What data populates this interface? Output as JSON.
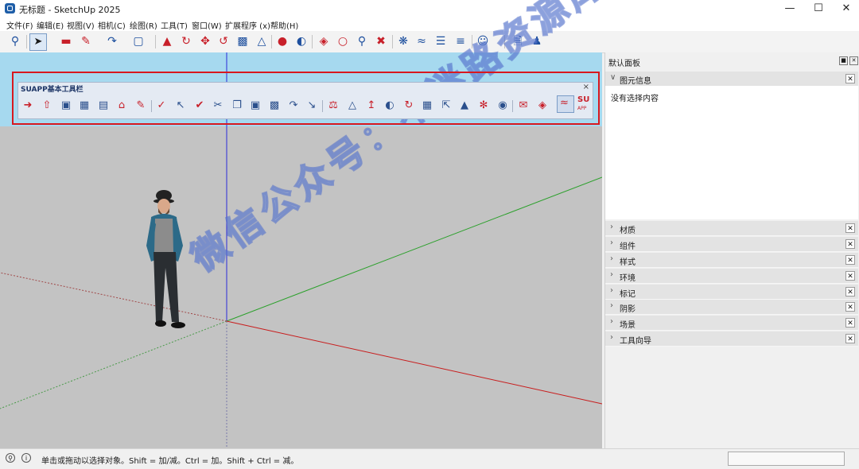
{
  "window": {
    "title": "无标题 - SketchUp 2025",
    "minimize": "—",
    "maximize": "☐",
    "close": "✕"
  },
  "menu": [
    "文件(F)",
    "编辑(E)",
    "视图(V)",
    "相机(C)",
    "绘图(R)",
    "工具(T)",
    "窗口(W)",
    "扩展程序 (x)",
    "帮助(H)"
  ],
  "toolbar": {
    "icons": [
      "search-icon",
      "select-arrow-icon",
      "eraser-icon",
      "pencil-icon",
      "arc-icon",
      "rectangle-icon",
      "push-pull-icon",
      "follow-me-icon",
      "move-icon",
      "rotate-icon",
      "scale-icon",
      "offset-icon",
      "tape-measure-icon",
      "protractor-icon",
      "section-icon",
      "orbit-icon",
      "pan-icon",
      "zoom-icon",
      "zoom-extents-icon",
      "warehouse-icon",
      "extension-warehouse-icon",
      "layout-icon",
      "style-builder-icon",
      "account-icon",
      "new-file-icon",
      "user-icon"
    ]
  },
  "suapp": {
    "title": "SUAPP基本工具栏",
    "close": "×",
    "su_label": "SU",
    "su_sub": "APP"
  },
  "watermark": "微信公众号：不迷路资源库",
  "panel": {
    "title": "默认面板",
    "entity_info": {
      "label": "图元信息",
      "status": "没有选择内容"
    },
    "sections": [
      "材质",
      "组件",
      "样式",
      "环境",
      "标记",
      "阴影",
      "场景",
      "工具向导"
    ]
  },
  "statusbar": {
    "text": "单击或拖动以选择对象。Shift = 加/减。Ctrl = 加。Shift + Ctrl = 减。"
  },
  "colors": {
    "accent": "#1d4f9e",
    "highlight_frame": "#d8181f",
    "sky": "#a6d9ef",
    "ground": "#c3c3c3"
  }
}
